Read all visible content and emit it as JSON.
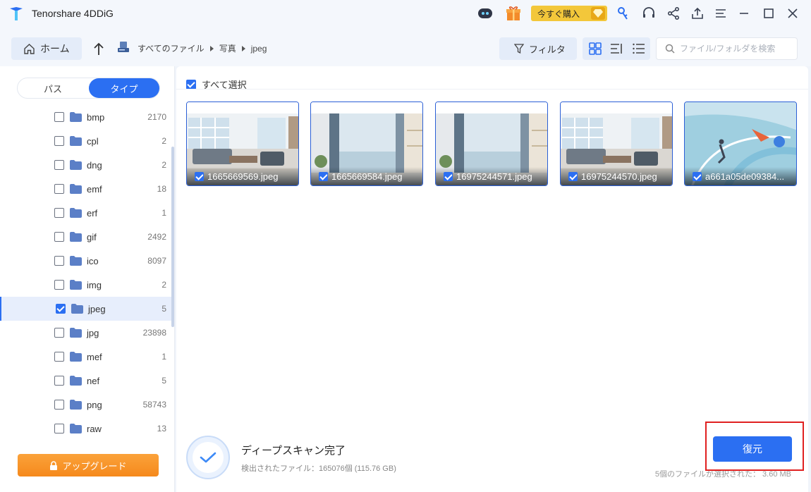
{
  "app": {
    "title": "Tenorshare 4DDiG",
    "buy_label": "今すぐ購入"
  },
  "toolbar": {
    "home_label": "ホーム",
    "breadcrumb": [
      "すべてのファイル",
      "写真",
      "jpeg"
    ],
    "filter_label": "フィルタ",
    "search_placeholder": "ファイル/フォルダを検索"
  },
  "sidebar": {
    "tabs": [
      "パス",
      "タイプ"
    ],
    "active_tab": "タイプ",
    "types": [
      {
        "name": "bmp",
        "count": "2170",
        "checked": false
      },
      {
        "name": "cpl",
        "count": "2",
        "checked": false
      },
      {
        "name": "dng",
        "count": "2",
        "checked": false
      },
      {
        "name": "emf",
        "count": "18",
        "checked": false
      },
      {
        "name": "erf",
        "count": "1",
        "checked": false
      },
      {
        "name": "gif",
        "count": "2492",
        "checked": false
      },
      {
        "name": "ico",
        "count": "8097",
        "checked": false
      },
      {
        "name": "img",
        "count": "2",
        "checked": false
      },
      {
        "name": "jpeg",
        "count": "5",
        "checked": true
      },
      {
        "name": "jpg",
        "count": "23898",
        "checked": false
      },
      {
        "name": "mef",
        "count": "1",
        "checked": false
      },
      {
        "name": "nef",
        "count": "5",
        "checked": false
      },
      {
        "name": "png",
        "count": "58743",
        "checked": false
      },
      {
        "name": "raw",
        "count": "13",
        "checked": false
      }
    ],
    "upgrade_label": "アップグレード"
  },
  "main": {
    "select_all_label": "すべて選択",
    "files": [
      {
        "name": "1665669569.jpeg",
        "scene": "living"
      },
      {
        "name": "1665669584.jpeg",
        "scene": "window"
      },
      {
        "name": "16975244571.jpeg",
        "scene": "window"
      },
      {
        "name": "16975244570.jpeg",
        "scene": "living"
      },
      {
        "name": "a661a05de09384...",
        "scene": "art"
      }
    ],
    "scan_title": "ディープスキャン完了",
    "scan_detail": "検出されたファイル：165076個 (115.76 GB)",
    "recover_label": "復元",
    "selection_status": "5個のファイルが選択された：  3.60 MB"
  },
  "colors": {
    "accent": "#2b6ff2",
    "upgrade": "#f7931e",
    "highlight": "#e02020"
  }
}
